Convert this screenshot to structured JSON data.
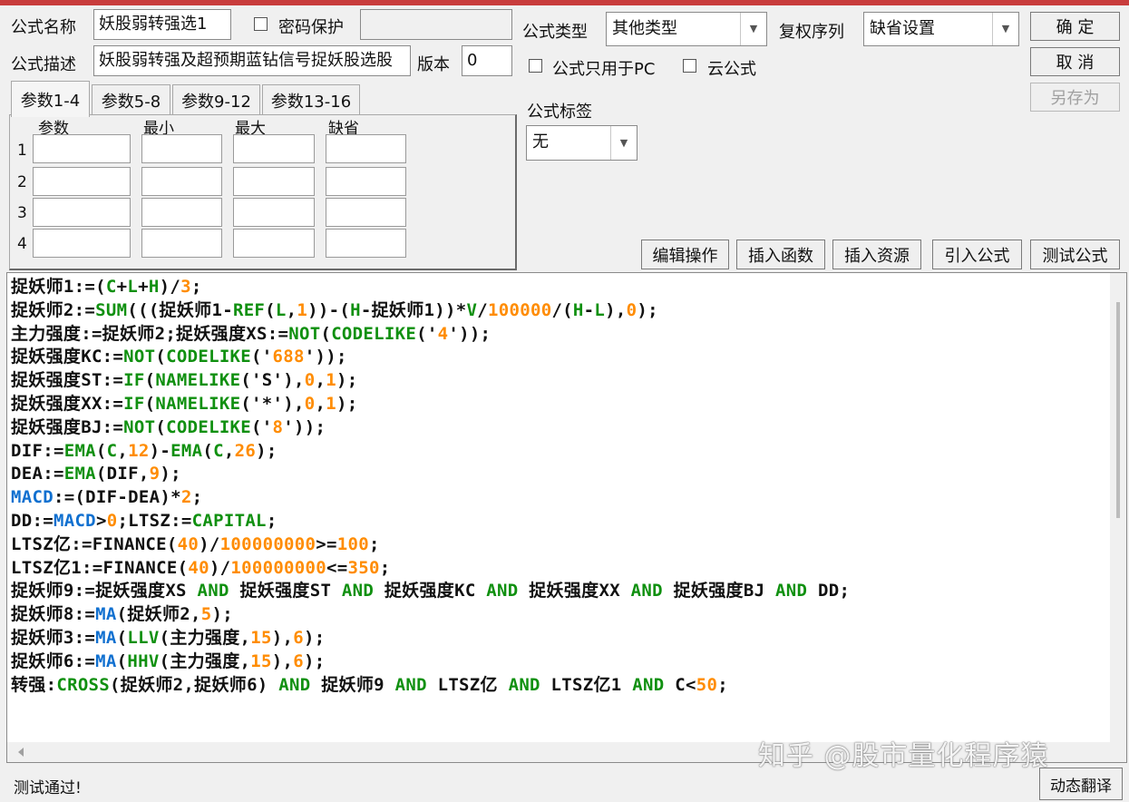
{
  "colors": {
    "title_bar_accent": "#c83c3c",
    "keyword_green": "#109010",
    "number_orange": "#ff8c00",
    "system_blue": "#1070d0",
    "text": "#111111"
  },
  "header": {
    "name_label": "公式名称",
    "name_value": "妖股弱转强选1",
    "password_label": "密码保护",
    "password_checked": false,
    "desc_label": "公式描述",
    "desc_value": "妖股弱转强及超预期蓝钻信号捉妖股选股",
    "version_label": "版本",
    "version_value": "0",
    "type_label": "公式类型",
    "type_value": "其他类型",
    "fq_label": "复权序列",
    "fq_value": "缺省设置",
    "pc_only_label": "公式只用于PC",
    "pc_only_checked": false,
    "cloud_label": "云公式",
    "cloud_checked": false,
    "tag_label": "公式标签",
    "tag_value": "无"
  },
  "dialog_buttons": {
    "ok": "确  定",
    "cancel": "取  消",
    "save_as": "另存为"
  },
  "tabs": [
    "参数1-4",
    "参数5-8",
    "参数9-12",
    "参数13-16"
  ],
  "params": {
    "headers": [
      "参数",
      "最小",
      "最大",
      "缺省"
    ],
    "rows": [
      "1",
      "2",
      "3",
      "4"
    ]
  },
  "toolbar": {
    "edit": "编辑操作",
    "insert_func": "插入函数",
    "insert_resource": "插入资源",
    "import_formula": "引入公式",
    "test_formula": "测试公式"
  },
  "code_lines": [
    [
      [
        "捉妖师1:=(",
        "t"
      ],
      [
        "C",
        "g"
      ],
      [
        "+",
        "t"
      ],
      [
        "L",
        "g"
      ],
      [
        "+",
        "t"
      ],
      [
        "H",
        "g"
      ],
      [
        ")/",
        "t"
      ],
      [
        "3",
        "o"
      ],
      [
        ";",
        "t"
      ]
    ],
    [
      [
        "捉妖师2:=",
        "t"
      ],
      [
        "SUM",
        "g"
      ],
      [
        "(((捉妖师1-",
        "t"
      ],
      [
        "REF",
        "g"
      ],
      [
        "(",
        "t"
      ],
      [
        "L",
        "g"
      ],
      [
        ",",
        "t"
      ],
      [
        "1",
        "o"
      ],
      [
        "))-(",
        "t"
      ],
      [
        "H",
        "g"
      ],
      [
        "-捉妖师1))*",
        "t"
      ],
      [
        "V",
        "g"
      ],
      [
        "/",
        "t"
      ],
      [
        "100000",
        "o"
      ],
      [
        "/(",
        "t"
      ],
      [
        "H",
        "g"
      ],
      [
        "-",
        "t"
      ],
      [
        "L",
        "g"
      ],
      [
        "),",
        "t"
      ],
      [
        "0",
        "o"
      ],
      [
        ");",
        "t"
      ]
    ],
    [
      [
        "主力强度:=捉妖师2;捉妖强度XS:=",
        "t"
      ],
      [
        "NOT",
        "g"
      ],
      [
        "(",
        "t"
      ],
      [
        "CODELIKE",
        "g"
      ],
      [
        "('",
        "t"
      ],
      [
        "4",
        "o"
      ],
      [
        "'));",
        "t"
      ]
    ],
    [
      [
        "捉妖强度KC:=",
        "t"
      ],
      [
        "NOT",
        "g"
      ],
      [
        "(",
        "t"
      ],
      [
        "CODELIKE",
        "g"
      ],
      [
        "('",
        "t"
      ],
      [
        "688",
        "o"
      ],
      [
        "'));",
        "t"
      ]
    ],
    [
      [
        "捉妖强度ST:=",
        "t"
      ],
      [
        "IF",
        "g"
      ],
      [
        "(",
        "t"
      ],
      [
        "NAMELIKE",
        "g"
      ],
      [
        "('S'),",
        "t"
      ],
      [
        "0",
        "o"
      ],
      [
        ",",
        "t"
      ],
      [
        "1",
        "o"
      ],
      [
        ");",
        "t"
      ]
    ],
    [
      [
        "捉妖强度XX:=",
        "t"
      ],
      [
        "IF",
        "g"
      ],
      [
        "(",
        "t"
      ],
      [
        "NAMELIKE",
        "g"
      ],
      [
        "('*'),",
        "t"
      ],
      [
        "0",
        "o"
      ],
      [
        ",",
        "t"
      ],
      [
        "1",
        "o"
      ],
      [
        ");",
        "t"
      ]
    ],
    [
      [
        "捉妖强度BJ:=",
        "t"
      ],
      [
        "NOT",
        "g"
      ],
      [
        "(",
        "t"
      ],
      [
        "CODELIKE",
        "g"
      ],
      [
        "('",
        "t"
      ],
      [
        "8",
        "o"
      ],
      [
        "'));",
        "t"
      ]
    ],
    [
      [
        "DIF:=",
        "t"
      ],
      [
        "EMA",
        "g"
      ],
      [
        "(",
        "t"
      ],
      [
        "C",
        "g"
      ],
      [
        ",",
        "t"
      ],
      [
        "12",
        "o"
      ],
      [
        ")-",
        "t"
      ],
      [
        "EMA",
        "g"
      ],
      [
        "(",
        "t"
      ],
      [
        "C",
        "g"
      ],
      [
        ",",
        "t"
      ],
      [
        "26",
        "o"
      ],
      [
        ");",
        "t"
      ]
    ],
    [
      [
        "DEA:=",
        "t"
      ],
      [
        "EMA",
        "g"
      ],
      [
        "(DIF,",
        "t"
      ],
      [
        "9",
        "o"
      ],
      [
        ");",
        "t"
      ]
    ],
    [
      [
        "MACD",
        "b"
      ],
      [
        ":=(DIF-DEA)*",
        "t"
      ],
      [
        "2",
        "o"
      ],
      [
        ";",
        "t"
      ]
    ],
    [
      [
        "DD:=",
        "t"
      ],
      [
        "MACD",
        "b"
      ],
      [
        ">",
        "t"
      ],
      [
        "0",
        "o"
      ],
      [
        ";LTSZ:=",
        "t"
      ],
      [
        "CAPITAL",
        "g"
      ],
      [
        ";",
        "t"
      ]
    ],
    [
      [
        "LTSZ亿:=FINANCE(",
        "t"
      ],
      [
        "40",
        "o"
      ],
      [
        ")/",
        "t"
      ],
      [
        "100000000",
        "o"
      ],
      [
        ">=",
        "t"
      ],
      [
        "100",
        "o"
      ],
      [
        ";",
        "t"
      ]
    ],
    [
      [
        "LTSZ亿1:=FINANCE(",
        "t"
      ],
      [
        "40",
        "o"
      ],
      [
        ")/",
        "t"
      ],
      [
        "100000000",
        "o"
      ],
      [
        "<=",
        "t"
      ],
      [
        "350",
        "o"
      ],
      [
        ";",
        "t"
      ]
    ],
    [
      [
        "捉妖师9:=捉妖强度XS ",
        "t"
      ],
      [
        "AND",
        "g"
      ],
      [
        " 捉妖强度ST ",
        "t"
      ],
      [
        "AND",
        "g"
      ],
      [
        " 捉妖强度KC ",
        "t"
      ],
      [
        "AND",
        "g"
      ],
      [
        " 捉妖强度XX ",
        "t"
      ],
      [
        "AND",
        "g"
      ],
      [
        " 捉妖强度BJ ",
        "t"
      ],
      [
        "AND",
        "g"
      ],
      [
        " DD;",
        "t"
      ]
    ],
    [
      [
        "捉妖师8:=",
        "t"
      ],
      [
        "MA",
        "b"
      ],
      [
        "(捉妖师2,",
        "t"
      ],
      [
        "5",
        "o"
      ],
      [
        ");",
        "t"
      ]
    ],
    [
      [
        "捉妖师3:=",
        "t"
      ],
      [
        "MA",
        "b"
      ],
      [
        "(",
        "t"
      ],
      [
        "LLV",
        "g"
      ],
      [
        "(主力强度,",
        "t"
      ],
      [
        "15",
        "o"
      ],
      [
        "),",
        "t"
      ],
      [
        "6",
        "o"
      ],
      [
        ");",
        "t"
      ]
    ],
    [
      [
        "捉妖师6:=",
        "t"
      ],
      [
        "MA",
        "b"
      ],
      [
        "(",
        "t"
      ],
      [
        "HHV",
        "g"
      ],
      [
        "(主力强度,",
        "t"
      ],
      [
        "15",
        "o"
      ],
      [
        "),",
        "t"
      ],
      [
        "6",
        "o"
      ],
      [
        ");",
        "t"
      ]
    ],
    [
      [
        "转强:",
        "t"
      ],
      [
        "CROSS",
        "g"
      ],
      [
        "(捉妖师2,捉妖师6) ",
        "t"
      ],
      [
        "AND",
        "g"
      ],
      [
        " 捉妖师9 ",
        "t"
      ],
      [
        "AND",
        "g"
      ],
      [
        " LTSZ亿 ",
        "t"
      ],
      [
        "AND",
        "g"
      ],
      [
        " LTSZ亿1 ",
        "t"
      ],
      [
        "AND",
        "g"
      ],
      [
        " C<",
        "t"
      ],
      [
        "50",
        "o"
      ],
      [
        ";",
        "t"
      ]
    ]
  ],
  "status_text": "测试通过!",
  "translate_button": "动态翻译",
  "watermark": "知乎 @股市量化程序猿"
}
